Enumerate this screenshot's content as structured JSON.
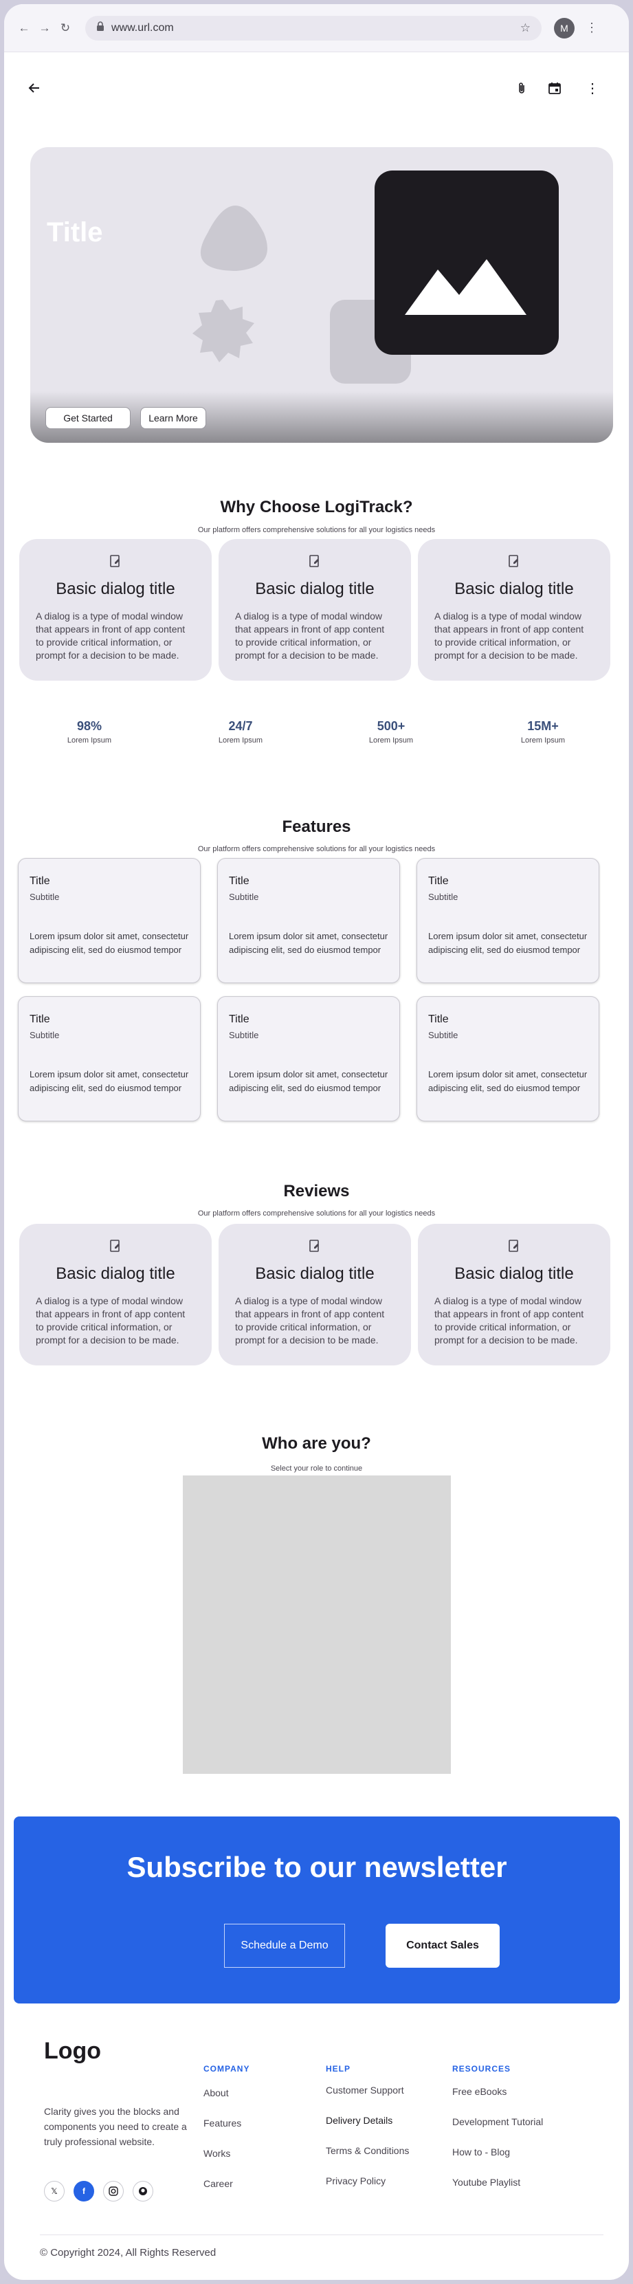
{
  "browser": {
    "url": "www.url.com",
    "avatar": "M"
  },
  "hero": {
    "title": "Title",
    "primary": "Get Started",
    "secondary": "Learn More"
  },
  "why": {
    "title": "Why Choose LogiTrack?",
    "subtitle": "Our platform offers comprehensive solutions for all your logistics needs",
    "cards": [
      {
        "title": "Basic dialog title",
        "body": "A dialog is a type of modal window that appears in front of app content to provide critical information, or prompt for a decision to be made."
      },
      {
        "title": "Basic dialog title",
        "body": "A dialog is a type of modal window that appears in front of app content to provide critical information, or prompt for a decision to be made."
      },
      {
        "title": "Basic dialog title",
        "body": "A dialog is a type of modal window that appears in front of app content to provide critical information, or prompt for a decision to be made."
      }
    ]
  },
  "stats": [
    {
      "value": "98%",
      "label": "Lorem Ipsum"
    },
    {
      "value": "24/7",
      "label": "Lorem Ipsum"
    },
    {
      "value": "500+",
      "label": "Lorem Ipsum"
    },
    {
      "value": "15M+",
      "label": "Lorem Ipsum"
    }
  ],
  "features": {
    "title": "Features",
    "subtitle": "Our platform offers comprehensive solutions for all your logistics needs",
    "cards": [
      {
        "title": "Title",
        "subtitle": "Subtitle",
        "body": "Lorem ipsum dolor sit amet, consectetur adipiscing elit, sed do eiusmod tempor"
      },
      {
        "title": "Title",
        "subtitle": "Subtitle",
        "body": "Lorem ipsum dolor sit amet, consectetur adipiscing elit, sed do eiusmod tempor"
      },
      {
        "title": "Title",
        "subtitle": "Subtitle",
        "body": "Lorem ipsum dolor sit amet, consectetur adipiscing elit, sed do eiusmod tempor"
      },
      {
        "title": "Title",
        "subtitle": "Subtitle",
        "body": "Lorem ipsum dolor sit amet, consectetur adipiscing elit, sed do eiusmod tempor"
      },
      {
        "title": "Title",
        "subtitle": "Subtitle",
        "body": "Lorem ipsum dolor sit amet, consectetur adipiscing elit, sed do eiusmod tempor"
      },
      {
        "title": "Title",
        "subtitle": "Subtitle",
        "body": "Lorem ipsum dolor sit amet, consectetur adipiscing elit, sed do eiusmod tempor"
      }
    ]
  },
  "reviews": {
    "title": "Reviews",
    "subtitle": "Our platform offers comprehensive solutions for all your logistics needs",
    "cards": [
      {
        "title": "Basic dialog title",
        "body": "A dialog is a type of modal window that appears in front of app content to provide critical information, or prompt for a decision to be made."
      },
      {
        "title": "Basic dialog title",
        "body": "A dialog is a type of modal window that appears in front of app content to provide critical information, or prompt for a decision to be made."
      },
      {
        "title": "Basic dialog title",
        "body": "A dialog is a type of modal window that appears in front of app content to provide critical information, or prompt for a decision to be made."
      }
    ]
  },
  "who": {
    "title": "Who are you?",
    "subtitle": "Select your role to continue"
  },
  "newsletter": {
    "title": "Subscribe to our newsletter",
    "demo": "Schedule a Demo",
    "sales": "Contact Sales"
  },
  "footer": {
    "logo": "Logo",
    "blurb": "Clarity gives you the blocks and components you need to create a truly professional website.",
    "company": {
      "heading": "COMPANY",
      "links": [
        "About",
        "Features",
        "Works",
        "Career"
      ]
    },
    "help": {
      "heading": "HELP",
      "links": [
        "Customer Support",
        "Delivery Details",
        "Terms & Conditions",
        "Privacy Policy"
      ]
    },
    "resources": {
      "heading": "RESOURCES",
      "links": [
        "Free eBooks",
        "Development Tutorial",
        "How to - Blog",
        "Youtube Playlist"
      ]
    },
    "copyright": "© Copyright 2024, All Rights Reserved"
  },
  "colors": {
    "accent": "#2663e4",
    "surface": "#e8e6ee"
  }
}
